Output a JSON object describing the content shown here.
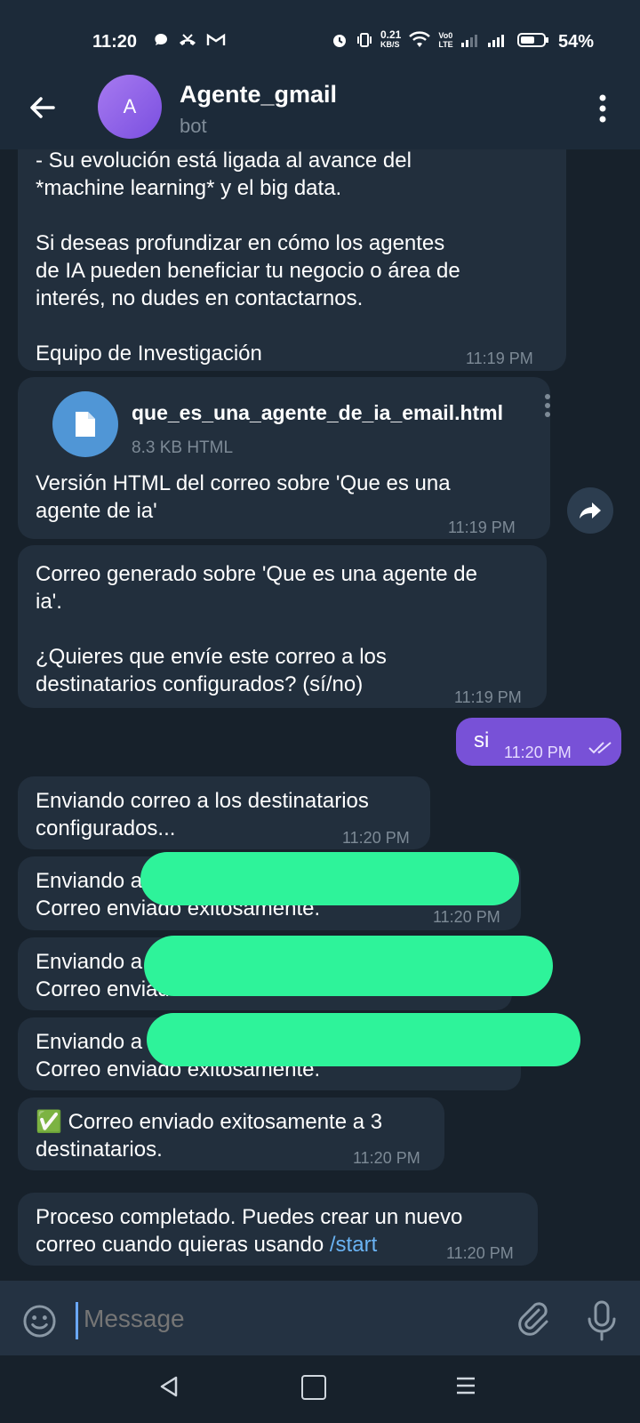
{
  "status": {
    "time": "11:20",
    "net_speed": "0.21",
    "net_unit": "KB/S",
    "volte": "Vo0\nLTE",
    "battery": "54%"
  },
  "header": {
    "avatar_letter": "A",
    "title": "Agente_gmail",
    "subtitle": "bot"
  },
  "messages": {
    "m1": {
      "text": "- Su evolución está ligada al avance del\n*machine learning* y el big data.\n\nSi deseas profundizar en cómo los agentes\nde IA pueden beneficiar tu negocio o área de\ninterés, no dudes en contactarnos.\n\nEquipo de Investigación",
      "time": "11:19 PM"
    },
    "file": {
      "name": "que_es_una_agente_de_ia_email.html",
      "meta": "8.3 KB HTML",
      "caption": "Versión HTML del correo sobre 'Que es una\nagente de ia'",
      "time": "11:19 PM"
    },
    "m3": {
      "text": "Correo generado sobre 'Que es una agente de\nia'.\n\n¿Quieres que envíe este correo a los\ndestinatarios configurados? (sí/no)",
      "time": "11:19 PM"
    },
    "mine": {
      "text": "si",
      "time": "11:20 PM"
    },
    "m5": {
      "text": "Enviando correo a los destinatarios\nconfigurados...",
      "time": "11:20 PM"
    },
    "m6": {
      "text": "Enviando a\nCorreo enviado exitosamente.",
      "time": "11:20 PM"
    },
    "m7": {
      "text": "Enviando a\nCorreo enviado exitosamente."
    },
    "m8": {
      "text": "Enviando a\nCorreo enviado exitosamente."
    },
    "m9": {
      "check_icon": "✅",
      "text": "Correo enviado exitosamente a 3\ndestinatarios.",
      "time": "11:20 PM"
    },
    "m10": {
      "text": "Proceso completado. Puedes crear un nuevo\ncorreo cuando quieras usando ",
      "link": "/start",
      "time": "11:20 PM"
    }
  },
  "input": {
    "placeholder": "Message"
  },
  "colors": {
    "accent": "#7851d7",
    "link": "#6ab3f3",
    "redaction": "#2ef39a"
  }
}
